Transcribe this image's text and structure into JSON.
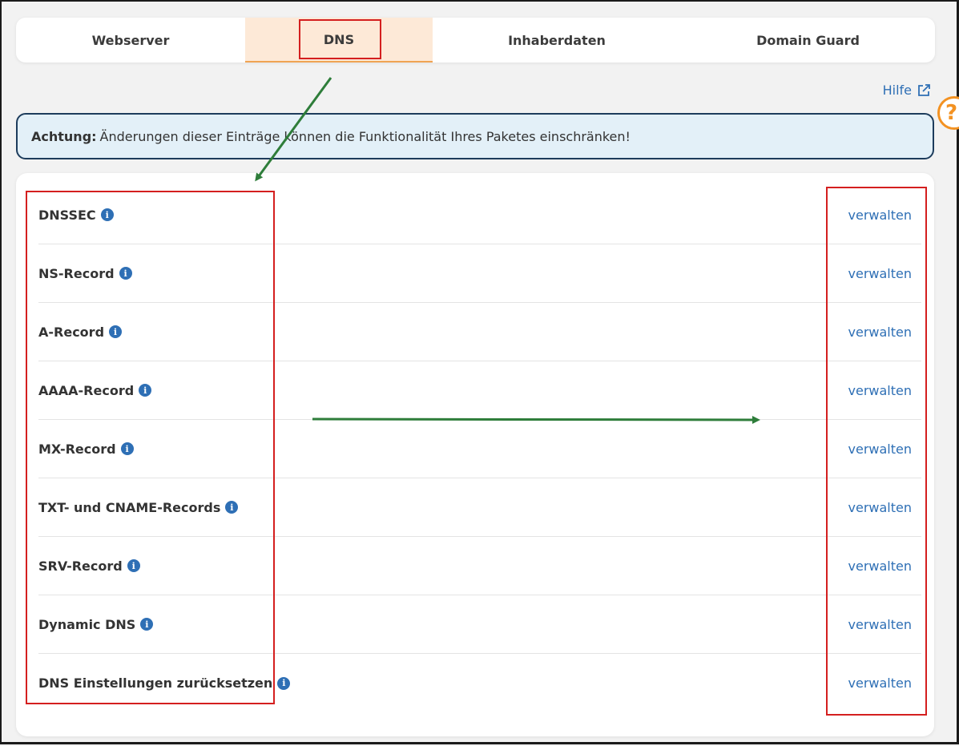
{
  "tabs": [
    {
      "label": "Webserver",
      "active": false
    },
    {
      "label": "DNS",
      "active": true
    },
    {
      "label": "Inhaberdaten",
      "active": false
    },
    {
      "label": "Domain Guard",
      "active": false
    }
  ],
  "help": {
    "label": "Hilfe",
    "icon": "external-link-icon"
  },
  "floating_help": {
    "glyph": "?",
    "icon": "help-circle-icon"
  },
  "alert": {
    "title": "Achtung:",
    "text": "Änderungen dieser Einträge können die Funktionalität Ihres Paketes einschränken!"
  },
  "records": [
    {
      "label": "DNSSEC",
      "action": "verwalten"
    },
    {
      "label": "NS-Record",
      "action": "verwalten"
    },
    {
      "label": "A-Record",
      "action": "verwalten"
    },
    {
      "label": "AAAA-Record",
      "action": "verwalten"
    },
    {
      "label": "MX-Record",
      "action": "verwalten"
    },
    {
      "label": "TXT- und CNAME-Records",
      "action": "verwalten"
    },
    {
      "label": "SRV-Record",
      "action": "verwalten"
    },
    {
      "label": "Dynamic DNS",
      "action": "verwalten"
    },
    {
      "label": "DNS Einstellungen zurücksetzen",
      "action": "verwalten"
    }
  ],
  "colors": {
    "accent": "#2e6fb5",
    "tab_active_bg": "#fde9d7",
    "tab_active_border": "#f0a453",
    "annotation_red": "#d41f1f",
    "annotation_green": "#2e7d3a"
  }
}
